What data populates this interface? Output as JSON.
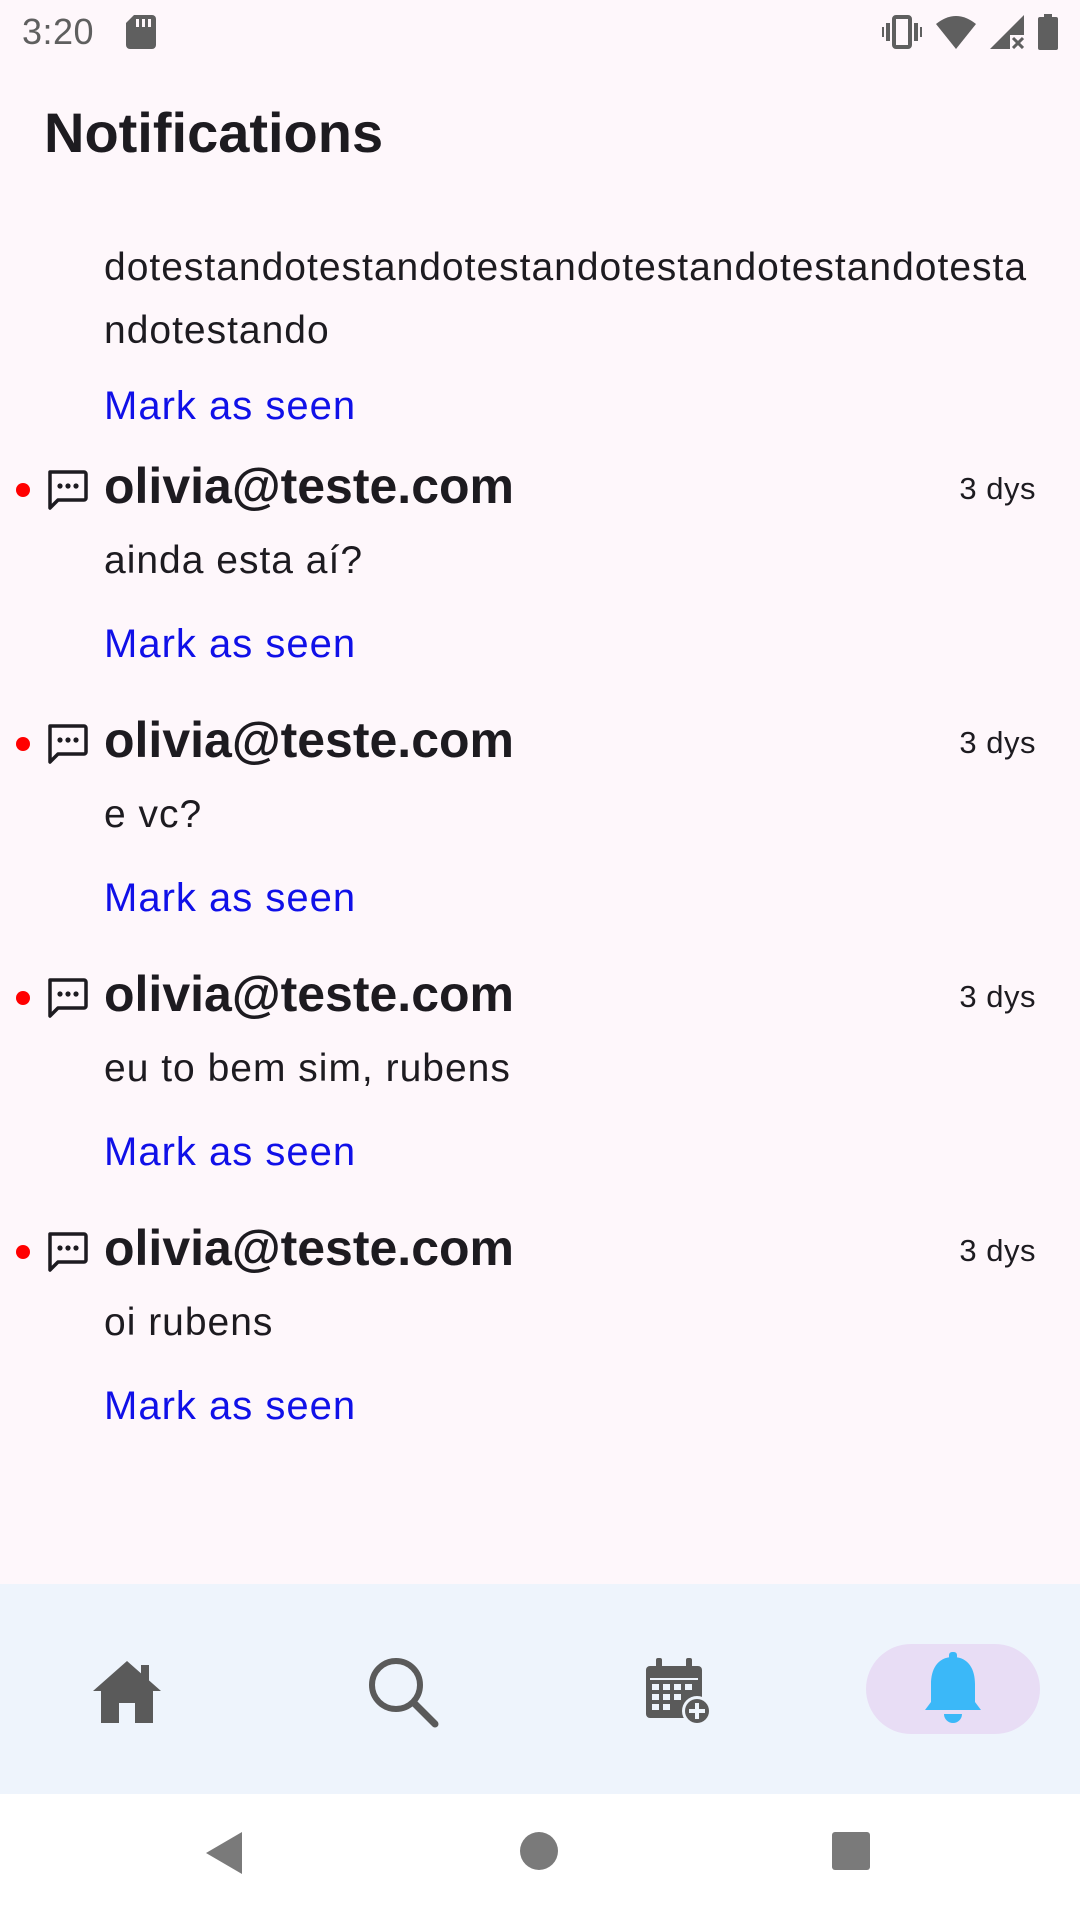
{
  "status_bar": {
    "time": "3:20",
    "icons": [
      "sd-card-icon",
      "vibrate-icon",
      "wifi-icon",
      "signal-no-data-icon",
      "battery-icon"
    ]
  },
  "header": {
    "title": "Notifications"
  },
  "notifications": [
    {
      "message": "dotestandotestandotestandotestandotestandotestandotestando",
      "action": "Mark as seen"
    },
    {
      "sender": "olivia@teste.com",
      "time": "3 dys",
      "message": "ainda esta aí?",
      "action": "Mark as seen",
      "unread": true
    },
    {
      "sender": "olivia@teste.com",
      "time": "3 dys",
      "message": "e vc?",
      "action": "Mark as seen",
      "unread": true
    },
    {
      "sender": "olivia@teste.com",
      "time": "3 dys",
      "message": "eu to bem sim, rubens",
      "action": "Mark as seen",
      "unread": true
    },
    {
      "sender": "olivia@teste.com",
      "time": "3 dys",
      "message": "oi rubens",
      "action": "Mark as seen",
      "unread": true
    }
  ],
  "bottom_nav": {
    "items": [
      {
        "icon": "home-icon"
      },
      {
        "icon": "search-icon"
      },
      {
        "icon": "calendar-add-icon"
      },
      {
        "icon": "bell-icon",
        "active": true
      }
    ]
  },
  "colors": {
    "background": "#fef7fb",
    "link": "#1010e8",
    "unread_dot": "#ff0000",
    "active_bell": "#3bb8f8",
    "active_pill": "#e8ddf5",
    "nav_background": "#eef4fc"
  }
}
